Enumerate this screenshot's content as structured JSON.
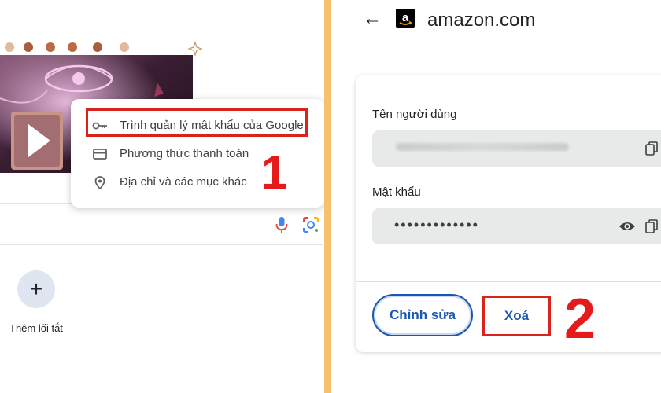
{
  "left": {
    "menu": {
      "items": [
        {
          "label": "Trình quản lý mật khẩu của Google",
          "icon": "key-icon"
        },
        {
          "label": "Phương thức thanh toán",
          "icon": "credit-card-icon"
        },
        {
          "label": "Địa chỉ và các mục khác",
          "icon": "location-pin-icon"
        }
      ]
    },
    "step_number": "1",
    "shortcut": {
      "symbol": "+",
      "label": "Thêm lối tắt"
    }
  },
  "right": {
    "back_symbol": "←",
    "site": "amazon.com",
    "username_label": "Tên người dùng",
    "password_label": "Mật khẩu",
    "password_masked": "•••••••••••••",
    "edit_button": "Chỉnh sửa",
    "delete_button": "Xoá",
    "step_number": "2"
  },
  "colors": {
    "highlight_red": "#d9231d",
    "number_red": "#e51b1b",
    "button_blue": "#1a57b0",
    "divider_orange": "#f5c26b",
    "field_grey": "#e8eaea"
  }
}
